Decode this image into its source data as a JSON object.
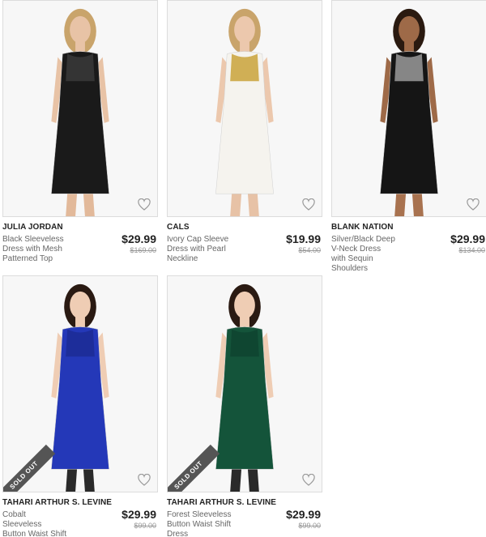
{
  "products": [
    {
      "brand": "JULIA JORDAN",
      "description": "Black Sleeveless Dress with Mesh Patterned Top",
      "price": "$29.99",
      "original_price": "$169.00",
      "sold_out": false,
      "dress_color": "#1a1a1a",
      "accent_color": "#3a3a3a",
      "hair_color": "#c9a46b",
      "legs_color": "#e2b99a"
    },
    {
      "brand": "CALS",
      "description": "Ivory Cap Sleeve Dress with Pearl Neckline",
      "price": "$19.99",
      "original_price": "$54.00",
      "sold_out": false,
      "dress_color": "#f5f3ee",
      "accent_color": "#c9a23a",
      "hair_color": "#c9a46b",
      "legs_color": "#e7c2a6"
    },
    {
      "brand": "BLANK NATION",
      "description": "Silver/Black Deep V-Neck Dress with Sequin Shoulders",
      "price": "$29.99",
      "original_price": "$134.00",
      "sold_out": false,
      "dress_color": "#151515",
      "accent_color": "#9a9a9a",
      "hair_color": "#2a1a10",
      "legs_color": "#a8724f"
    },
    {
      "brand": "TAHARI ARTHUR S. LEVINE",
      "description": "Cobalt Sleeveless Button Waist Shift Dress",
      "price": "$29.99",
      "original_price": "$99.00",
      "sold_out": true,
      "sold_out_label": "SOLD OUT",
      "dress_color": "#2438b8",
      "accent_color": "#1c2c94",
      "hair_color": "#2a1a12",
      "legs_color": "#2a2a2a"
    },
    {
      "brand": "TAHARI ARTHUR S. LEVINE",
      "description": "Forest Sleeveless Button Waist Shift Dress",
      "price": "$29.99",
      "original_price": "$99.00",
      "sold_out": true,
      "sold_out_label": "SOLD OUT",
      "dress_color": "#14543a",
      "accent_color": "#0e4430",
      "hair_color": "#2a1a12",
      "legs_color": "#2a2a2a"
    }
  ],
  "icons": {
    "favorite": "heart-outline-icon"
  },
  "colors": {
    "border": "#dcdcdc",
    "price": "#222222",
    "original_price": "#999999",
    "sold_out_banner": "#555555"
  }
}
